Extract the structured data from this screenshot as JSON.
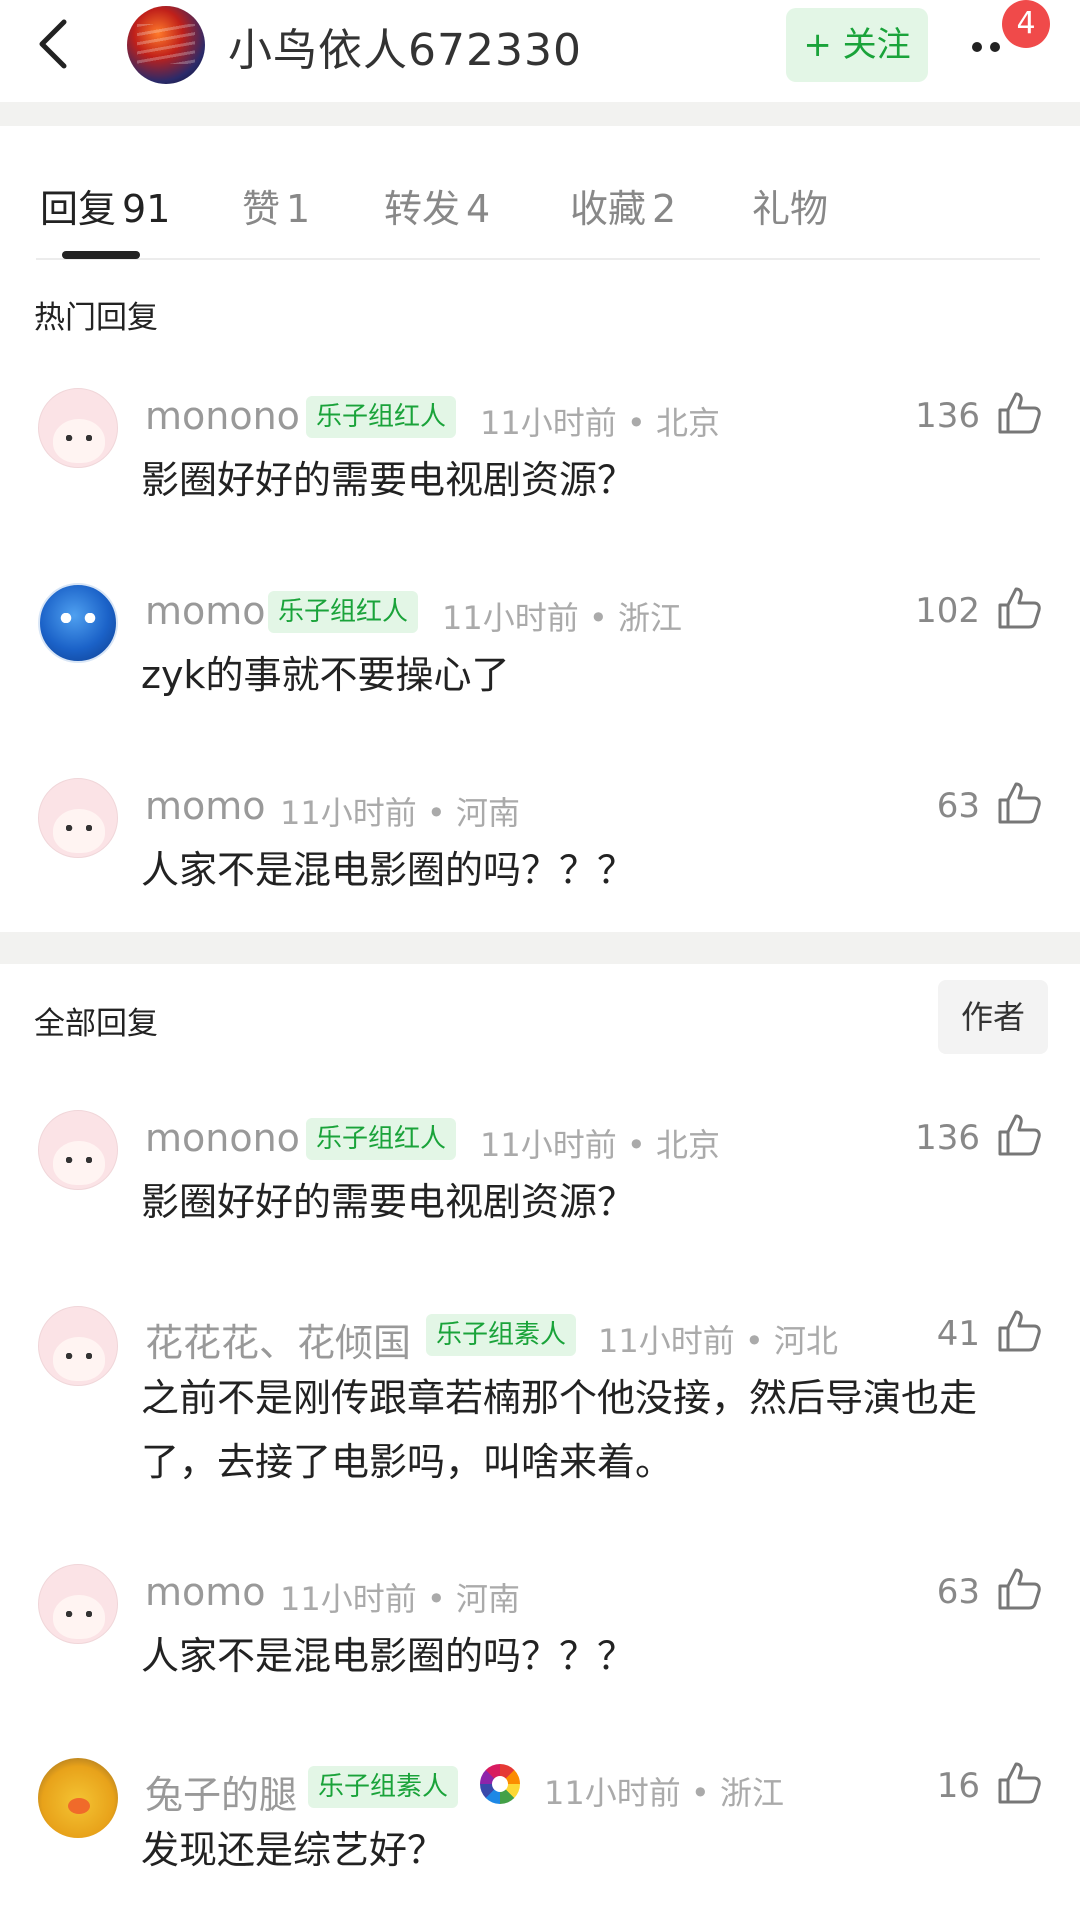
{
  "header": {
    "username": "小鸟依人672330",
    "follow_label": "+ 关注",
    "notification_count": "4"
  },
  "tabs": [
    {
      "label": "回复",
      "count": "91"
    },
    {
      "label": "赞",
      "count": "1"
    },
    {
      "label": "转发",
      "count": "4"
    },
    {
      "label": "收藏",
      "count": "2"
    },
    {
      "label": "礼物",
      "count": ""
    }
  ],
  "hot_section": {
    "title": "热门回复",
    "comments": [
      {
        "name": "monono",
        "badge": "乐子组红人",
        "meta": "11小时前 • 北京",
        "likes": "136",
        "text": "影圈好好的需要电视剧资源？",
        "avatar": "pink-bunny"
      },
      {
        "name": "momo",
        "badge": "乐子组红人",
        "meta": "11小时前 • 浙江",
        "likes": "102",
        "text": "zyk的事就不要操心了",
        "avatar": "blue-face"
      },
      {
        "name": "momo",
        "badge": "",
        "meta": "11小时前 • 河南",
        "likes": "63",
        "text": "人家不是混电影圈的吗？？？",
        "avatar": "pink-bunny"
      }
    ]
  },
  "all_section": {
    "title": "全部回复",
    "author_filter": "作者",
    "comments": [
      {
        "name": "monono",
        "badge": "乐子组红人",
        "meta": "11小时前 • 北京",
        "likes": "136",
        "text": "影圈好好的需要电视剧资源？",
        "avatar": "pink-bunny"
      },
      {
        "name": "花花花、花倾国",
        "badge": "乐子组素人",
        "meta": "11小时前 • 河北",
        "likes": "41",
        "text": "之前不是刚传跟章若楠那个他没接，然后导演也走了，去接了电影吗，叫啥来着。",
        "avatar": "pink-bunny"
      },
      {
        "name": "momo",
        "badge": "",
        "meta": "11小时前 • 河南",
        "likes": "63",
        "text": "人家不是混电影圈的吗？？？",
        "avatar": "pink-bunny"
      },
      {
        "name": "兔子的腿",
        "badge": "乐子组素人",
        "meta": "11小时前 • 浙江",
        "likes": "16",
        "text": "发现还是综艺好？",
        "avatar": "chick"
      }
    ]
  }
}
